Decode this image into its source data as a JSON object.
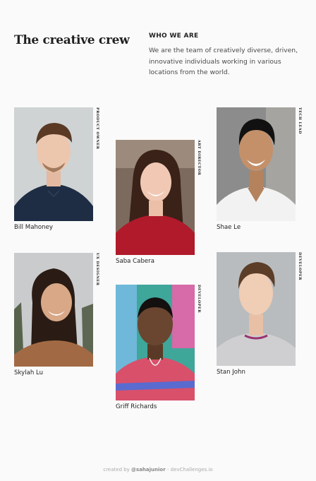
{
  "header": {
    "title": "The creative crew",
    "who_heading": "WHO WE ARE",
    "who_text": "We are the team of creatively diverse, driven, innovative individuals working in various locations from the world."
  },
  "members": [
    {
      "name": "Bill Mahoney",
      "role": "PRODUCT OWNER"
    },
    {
      "name": "Saba Cabera",
      "role": "ART DIRECTOR"
    },
    {
      "name": "Shae Le",
      "role": "TECH LEAD"
    },
    {
      "name": "Skylah Lu",
      "role": "UX DESIGNER"
    },
    {
      "name": "Griff Richards",
      "role": "DEVELOPER"
    },
    {
      "name": "Stan John",
      "role": "DEVELOPER"
    }
  ],
  "footer": {
    "prefix": "created by ",
    "author": "@sahajunior",
    "suffix": " - devChallenges.io"
  },
  "colors": {
    "background": "#fafafa",
    "text": "#1f1f1f",
    "muted": "#4a4a4a"
  }
}
